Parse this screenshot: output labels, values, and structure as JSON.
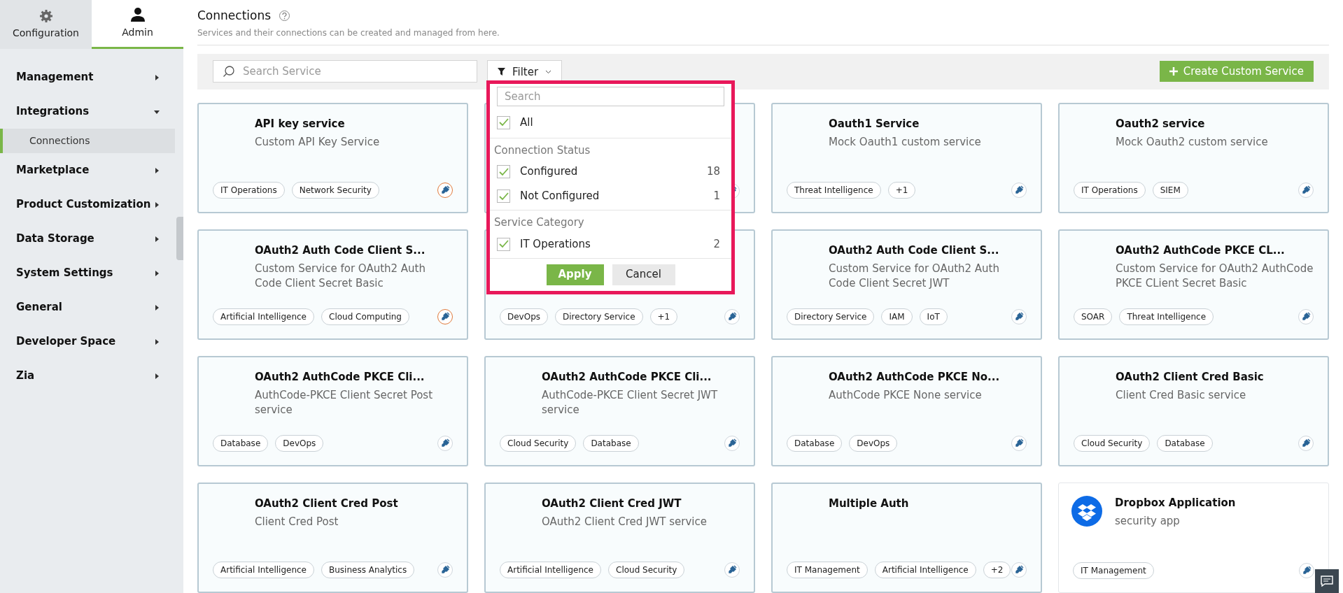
{
  "top_tabs": [
    {
      "label": "Configuration",
      "kind": "gear",
      "selected": false
    },
    {
      "label": "Admin",
      "kind": "user",
      "selected": true
    }
  ],
  "nav": [
    {
      "label": "Management",
      "expanded": false
    },
    {
      "label": "Integrations",
      "expanded": true,
      "children": [
        {
          "label": "Connections",
          "selected": true
        }
      ]
    },
    {
      "label": "Marketplace",
      "expanded": false
    },
    {
      "label": "Product Customization",
      "expanded": false
    },
    {
      "label": "Data Storage",
      "expanded": false
    },
    {
      "label": "System Settings",
      "expanded": false
    },
    {
      "label": "General",
      "expanded": false
    },
    {
      "label": "Developer Space",
      "expanded": false
    },
    {
      "label": "Zia",
      "expanded": false
    }
  ],
  "header": {
    "title": "Connections",
    "subtitle": "Services and their connections can be created and managed from here."
  },
  "toolbar": {
    "search_placeholder": "Search Service",
    "filter_label": "Filter",
    "create_button": "Create Custom Service"
  },
  "filter_dropdown": {
    "search_placeholder": "Search",
    "all": {
      "label": "All",
      "checked": true
    },
    "groups": [
      {
        "heading": "Connection Status",
        "options": [
          {
            "label": "Configured",
            "count": "18",
            "checked": true
          },
          {
            "label": "Not Configured",
            "count": "1",
            "checked": true
          }
        ]
      },
      {
        "heading": "Service Category",
        "options": [
          {
            "label": "IT Operations",
            "count": "2",
            "checked": true
          }
        ]
      }
    ],
    "apply": "Apply",
    "cancel": "Cancel"
  },
  "cards": [
    {
      "kind": "custom",
      "title": "API key service",
      "description": "Custom API Key Service",
      "tags": [
        "IT Operations",
        "Network Security"
      ],
      "configured": false
    },
    {
      "kind": "custom",
      "configured": true
    },
    {
      "kind": "custom",
      "title": "Oauth1 Service",
      "description": "Mock Oauth1 custom service",
      "tags": [
        "Threat Intelligence",
        "+1"
      ],
      "configured": true
    },
    {
      "kind": "custom",
      "title": "Oauth2 service",
      "description": "Mock Oauth2 custom service",
      "tags": [
        "IT Operations",
        "SIEM"
      ],
      "configured": true
    },
    {
      "kind": "custom",
      "title": "OAuth2 Auth Code Client S...",
      "description": "Custom Service for OAuth2 Auth Code Client Secret Basic",
      "tags": [
        "Artificial Intelligence",
        "Cloud Computing"
      ],
      "configured": false
    },
    {
      "kind": "custom",
      "tags": [
        "DevOps",
        "Directory Service",
        "+1"
      ],
      "configured": true
    },
    {
      "kind": "custom",
      "title": "OAuth2 Auth Code Client S...",
      "description": "Custom Service for OAuth2 Auth Code Client Secret JWT",
      "tags": [
        "Directory Service",
        "IAM",
        "IoT"
      ],
      "configured": true
    },
    {
      "kind": "custom",
      "title": "OAuth2 AuthCode PKCE CL...",
      "description": "Custom Service for OAuth2 AuthCode PKCE CLient Secret Basic",
      "tags": [
        "SOAR",
        "Threat Intelligence"
      ],
      "configured": true
    },
    {
      "kind": "custom",
      "title": "OAuth2 AuthCode PKCE Cli...",
      "description": "AuthCode-PKCE Client Secret Post service",
      "tags": [
        "Database",
        "DevOps"
      ],
      "configured": true
    },
    {
      "kind": "custom",
      "title": "OAuth2 AuthCode PKCE Cli...",
      "description": "AuthCode-PKCE Client Secret JWT service",
      "tags": [
        "Cloud Security",
        "Database"
      ],
      "configured": true
    },
    {
      "kind": "custom",
      "title": "OAuth2 AuthCode PKCE No...",
      "description": "AuthCode PKCE None service",
      "tags": [
        "Database",
        "DevOps"
      ],
      "configured": true
    },
    {
      "kind": "custom",
      "title": "OAuth2 Client Cred Basic",
      "description": "Client Cred Basic service",
      "tags": [
        "Cloud Security",
        "Database"
      ],
      "configured": true
    },
    {
      "kind": "custom",
      "title": "OAuth2 Client Cred Post",
      "description": "Client Cred Post",
      "tags": [
        "Artificial Intelligence",
        "Business Analytics"
      ],
      "configured": true
    },
    {
      "kind": "custom",
      "title": "OAuth2 Client Cred JWT",
      "description": "OAuth2 Client Cred JWT service",
      "tags": [
        "Artificial Intelligence",
        "Cloud Security"
      ],
      "configured": true
    },
    {
      "kind": "custom",
      "title": "Multiple Auth",
      "tags": [
        "IT Management",
        "Artificial Intelligence",
        "+2"
      ],
      "configured": true
    },
    {
      "kind": "app",
      "title": "Dropbox Application",
      "description": "security app",
      "tags": [
        "IT Management"
      ],
      "configured": true
    }
  ]
}
